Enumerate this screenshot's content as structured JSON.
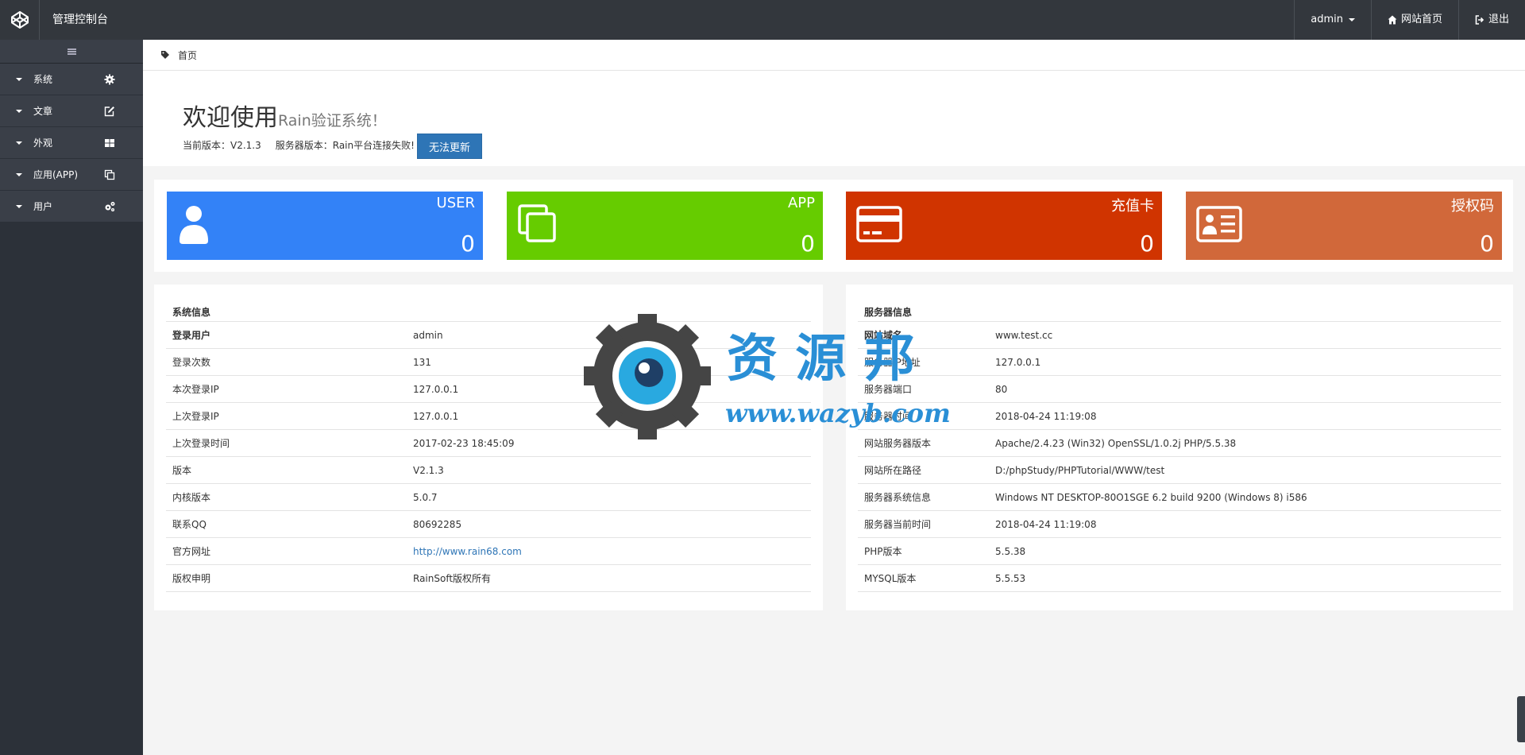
{
  "header": {
    "title": "管理控制台",
    "user_label": "admin",
    "home_label": "网站首页",
    "logout_label": "退出"
  },
  "sidebar": {
    "items": [
      {
        "label": "系统",
        "icon": "gear-icon"
      },
      {
        "label": "文章",
        "icon": "edit-icon"
      },
      {
        "label": "外观",
        "icon": "grid-icon"
      },
      {
        "label": "应用(APP)",
        "icon": "copy-icon"
      },
      {
        "label": "用户",
        "icon": "cogs-icon"
      }
    ]
  },
  "breadcrumb": {
    "text": "首页"
  },
  "welcome": {
    "title_main": "欢迎使用",
    "title_sub": "Rain验证系统！",
    "current_version": "当前版本：V2.1.3",
    "server_version": "服务器版本：Rain平台连接失败!",
    "update_button": "无法更新"
  },
  "stats": [
    {
      "label": "USER",
      "value": "0",
      "color": "#3382f7"
    },
    {
      "label": "APP",
      "value": "0",
      "color": "#66cc00"
    },
    {
      "label": "充值卡",
      "value": "0",
      "color": "#d03400"
    },
    {
      "label": "授权码",
      "value": "0",
      "color": "#d1683a"
    }
  ],
  "system_info": {
    "title": "系统信息",
    "rows": [
      {
        "k": "登录用户",
        "v": "admin"
      },
      {
        "k": "登录次数",
        "v": "131"
      },
      {
        "k": "本次登录IP",
        "v": "127.0.0.1"
      },
      {
        "k": "上次登录IP",
        "v": "127.0.0.1"
      },
      {
        "k": "上次登录时间",
        "v": "2017-02-23 18:45:09"
      },
      {
        "k": "版本",
        "v": "V2.1.3"
      },
      {
        "k": "内核版本",
        "v": "5.0.7"
      },
      {
        "k": "联系QQ",
        "v": "80692285"
      },
      {
        "k": "官方网址",
        "v": "http://www.rain68.com"
      },
      {
        "k": "版权申明",
        "v": "RainSoft版权所有"
      }
    ]
  },
  "server_info": {
    "title": "服务器信息",
    "rows": [
      {
        "k": "网站域名",
        "v": "www.test.cc"
      },
      {
        "k": "服务器IP地址",
        "v": "127.0.0.1"
      },
      {
        "k": "服务器端口",
        "v": "80"
      },
      {
        "k": "服务器时间",
        "v": "2018-04-24 11:19:08"
      },
      {
        "k": "网站服务器版本",
        "v": "Apache/2.4.23 (Win32) OpenSSL/1.0.2j PHP/5.5.38"
      },
      {
        "k": "网站所在路径",
        "v": "D:/phpStudy/PHPTutorial/WWW/test"
      },
      {
        "k": "服务器系统信息",
        "v": "Windows NT DESKTOP-80O1SGE 6.2 build 9200 (Windows 8) i586"
      },
      {
        "k": "服务器当前时间",
        "v": "2018-04-24 11:19:08"
      },
      {
        "k": "PHP版本",
        "v": "5.5.38"
      },
      {
        "k": "MYSQL版本",
        "v": "5.5.53"
      }
    ]
  },
  "watermark": {
    "line1": "资 源 邦",
    "line2": "www.wazyb.com"
  }
}
